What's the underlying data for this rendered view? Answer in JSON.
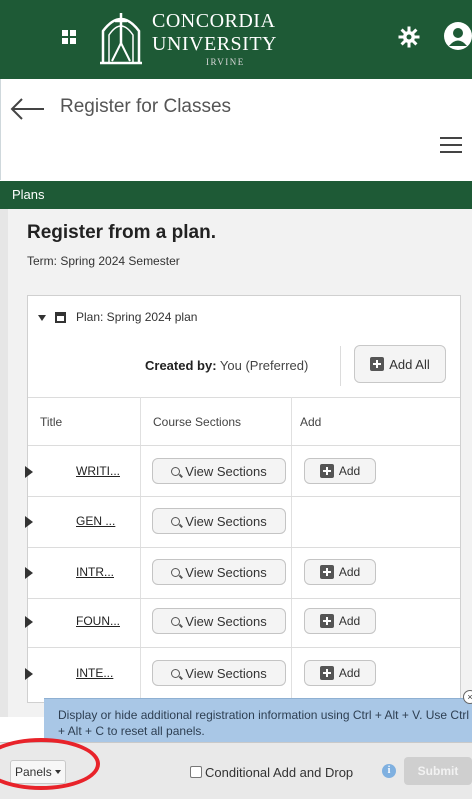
{
  "header": {
    "brand_line1": "CONCORDIA",
    "brand_line2": "UNIVERSITY",
    "brand_line3": "IRVINE",
    "bar_color": "#1e5a36",
    "icons": [
      "grid-icon",
      "university-logo",
      "gear-icon",
      "user-avatar-icon"
    ]
  },
  "page": {
    "title": "Register for Classes",
    "back_icon": "arrow-left-icon",
    "menu_icon": "hamburger-icon"
  },
  "tab_bar": {
    "label": "Plans"
  },
  "main": {
    "heading": "Register from a plan.",
    "term": "Term: Spring 2024 Semester",
    "plan": {
      "label": "Plan: Spring 2024 plan",
      "created_by_label": "Created by:",
      "created_by_value": " You (Preferred)",
      "add_all_label": "Add All"
    },
    "table": {
      "columns": [
        "Title",
        "Course Sections",
        "Add"
      ],
      "rows": [
        {
          "title": "WRITI...",
          "view_label": "View Sections",
          "add_label": "Add"
        },
        {
          "title": "GEN ...",
          "view_label": "View Sections",
          "add_label": ""
        },
        {
          "title": "INTR...",
          "view_label": "View Sections",
          "add_label": "Add"
        },
        {
          "title": "FOUN...",
          "view_label": "View Sections",
          "add_label": "Add"
        },
        {
          "title": "INTE...",
          "view_label": "View Sections",
          "add_label": "Add"
        }
      ]
    }
  },
  "tooltip": {
    "text": "Display or hide additional registration information using Ctrl + Alt + V. Use Ctrl + Alt + C to reset all panels.",
    "close_glyph": "×"
  },
  "footer": {
    "panels_label": "Panels",
    "conditional_label": "Conditional Add and Drop",
    "info_glyph": "i",
    "submit_label": "Submit",
    "highlight_color": "#e8232a"
  }
}
